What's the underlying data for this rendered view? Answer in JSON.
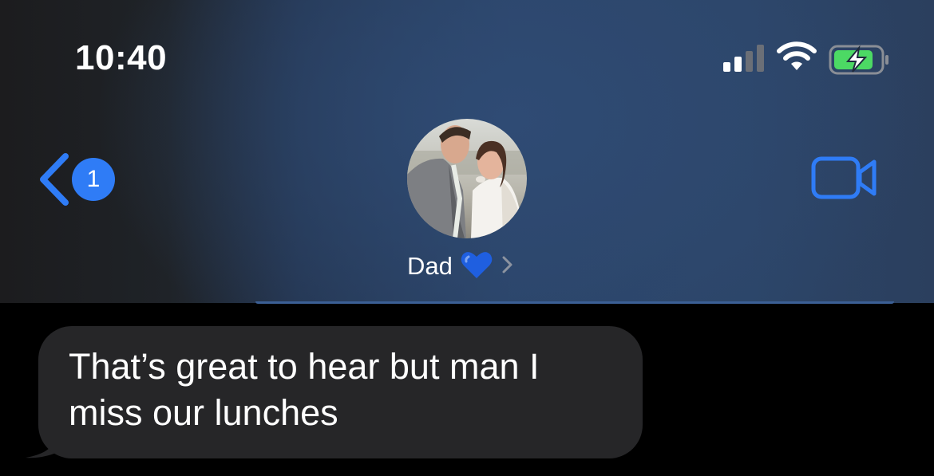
{
  "status_bar": {
    "time": "10:40",
    "signal_icon": "cellular-signal-icon",
    "wifi_icon": "wifi-icon",
    "battery_icon": "battery-charging-icon",
    "battery_color": "#4cd964"
  },
  "nav": {
    "back_icon": "chevron-left-icon",
    "unread_count": "1",
    "video_icon": "video-camera-icon",
    "accent_color": "#2f7cf6"
  },
  "contact": {
    "name": "Dad",
    "emoji": "💙",
    "chevron": "›"
  },
  "messages": [
    {
      "direction": "received",
      "text": "That’s great to hear but man I miss our lunches"
    }
  ]
}
